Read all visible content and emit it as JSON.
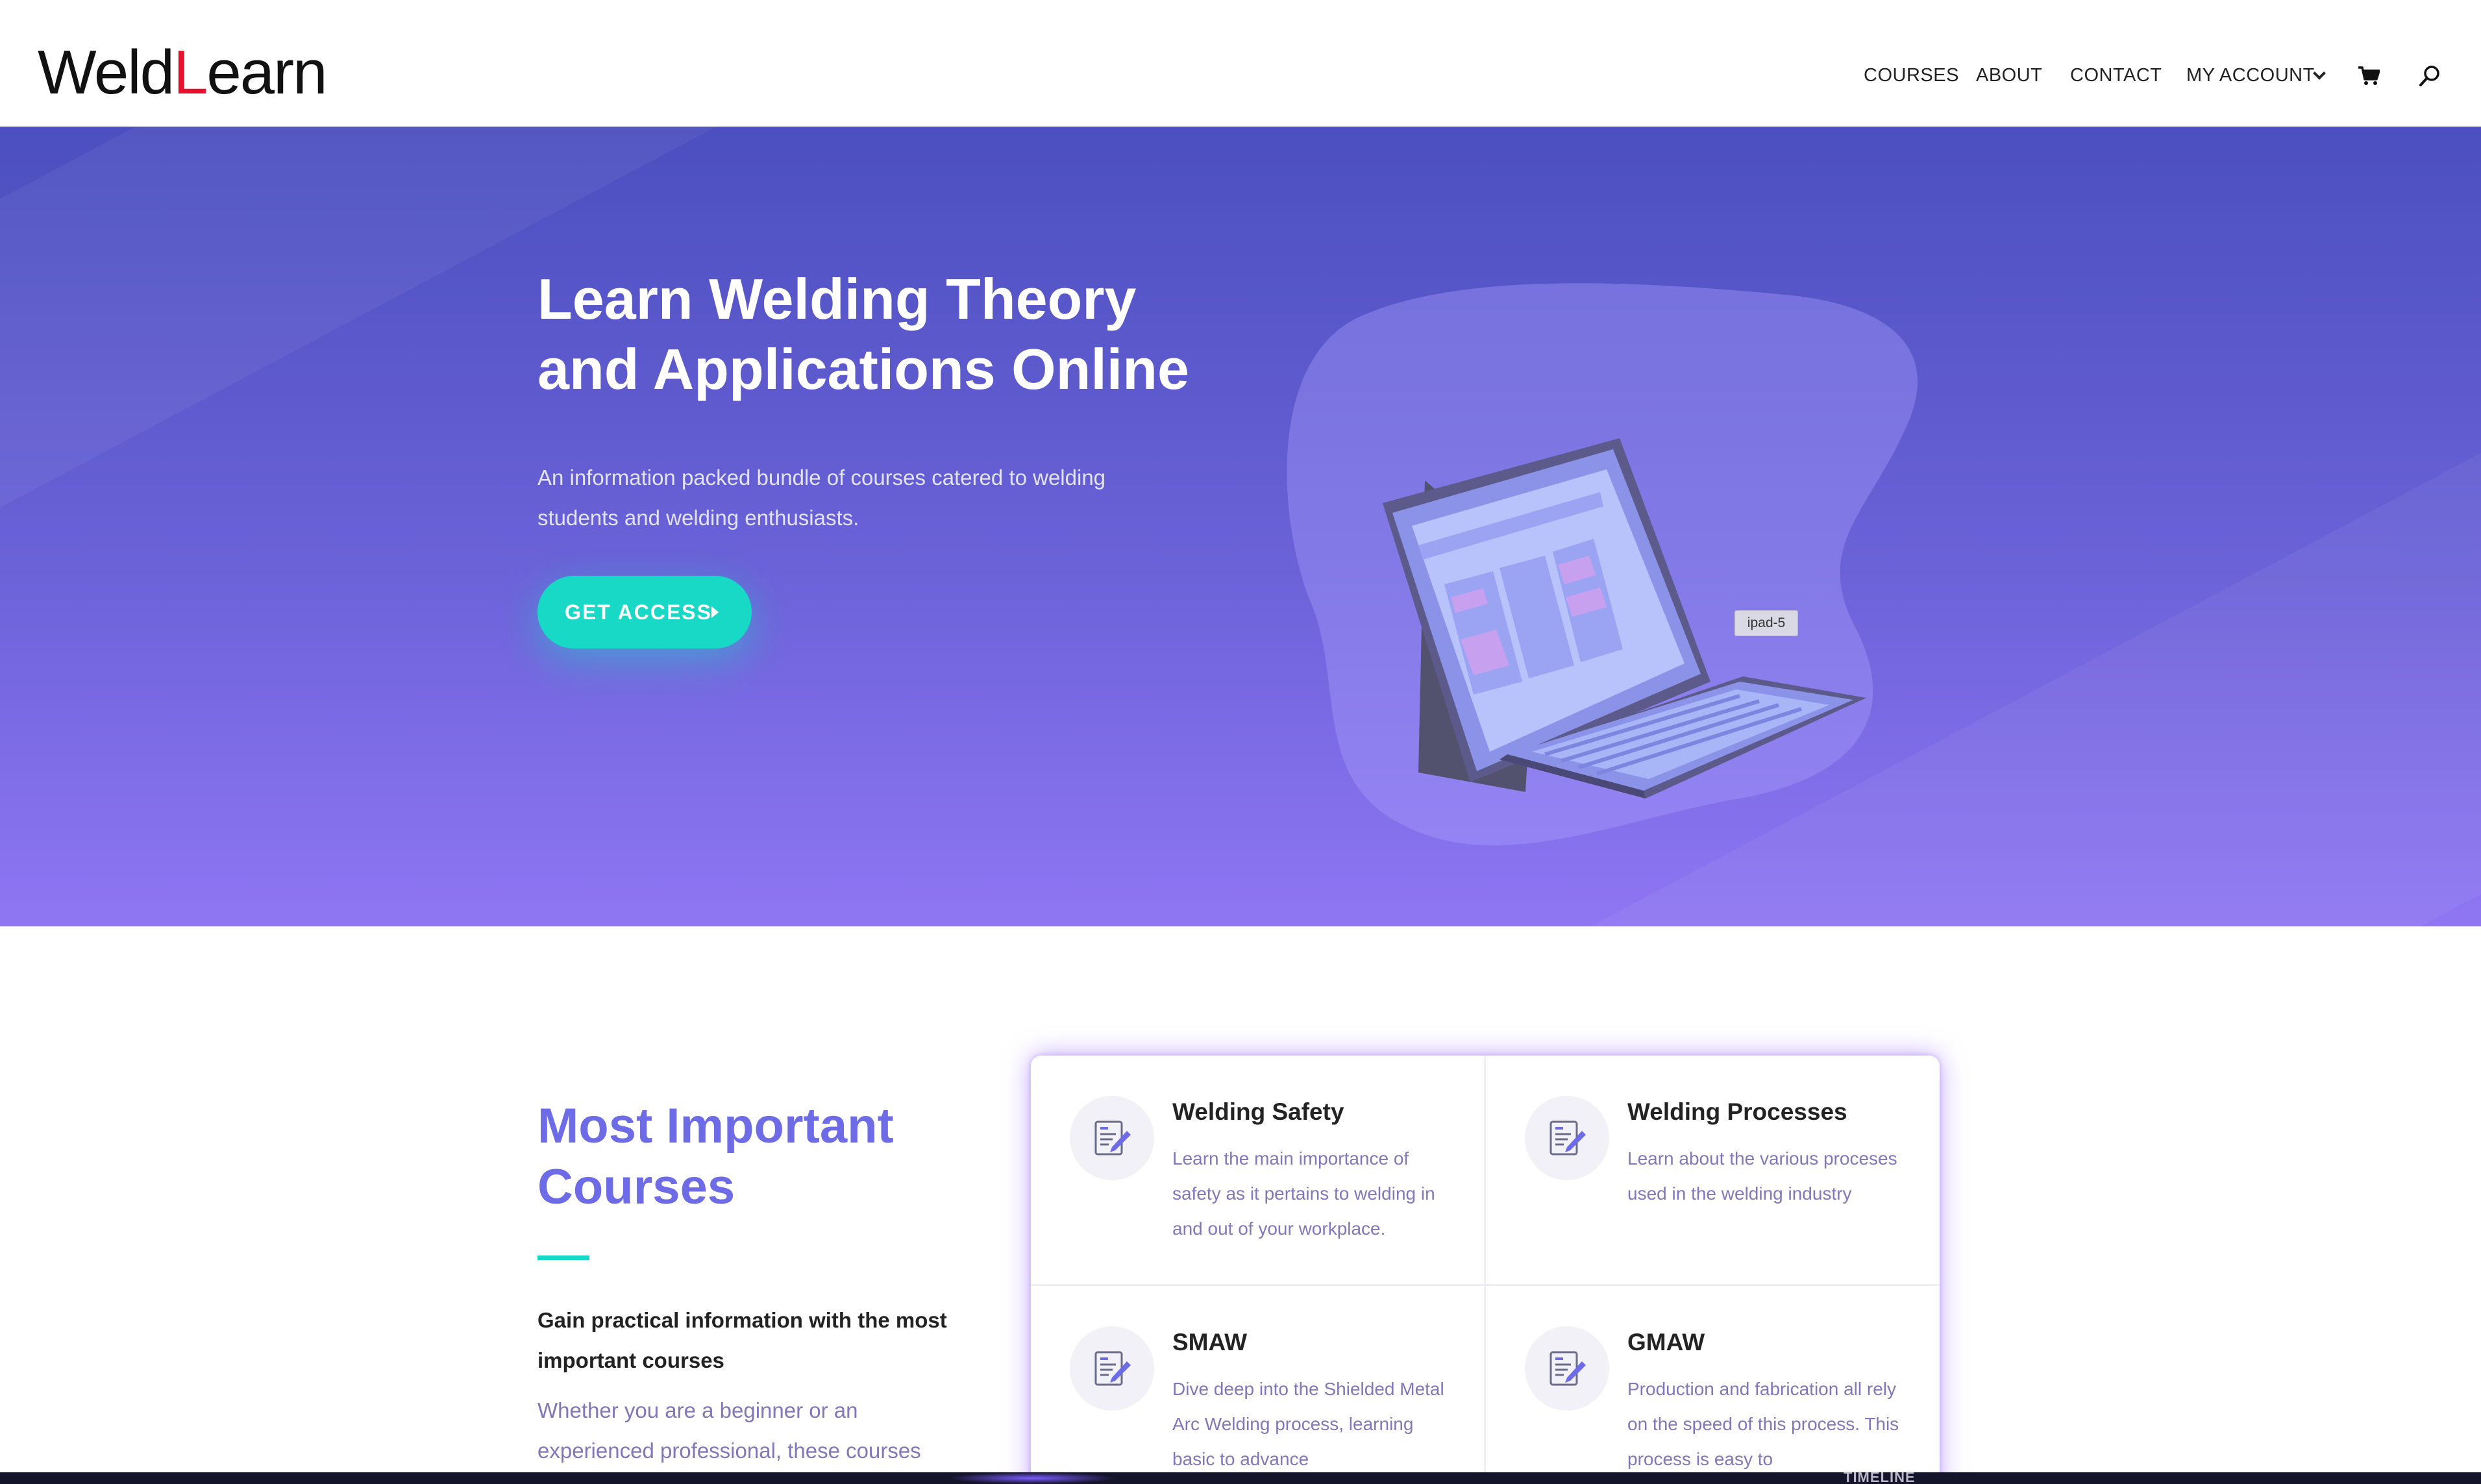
{
  "header": {
    "logo_part1": "Weld",
    "logo_part2": "L",
    "logo_part3": "earn",
    "nav": [
      "COURSES",
      "ABOUT",
      "CONTACT",
      "MY ACCOUNT"
    ],
    "icons": [
      "cart-icon",
      "search-icon",
      "chevron-down-icon"
    ]
  },
  "hero": {
    "title": "Learn Welding Theory and Applications Online",
    "subtitle": "An information packed bundle of courses catered to welding students and welding enthusiasts.",
    "cta_label": "GET ACCESS",
    "image_tag": "ipad-5"
  },
  "courses": {
    "heading": "Most Important Courses",
    "lead": "Gain practical information with the most important courses",
    "body": "Whether you are a beginner or an experienced professional, these courses",
    "cards": [
      {
        "title": "Welding Safety",
        "desc": "Learn the main importance of safety as it pertains to welding in and out of your workplace.",
        "icon": "document-edit-icon"
      },
      {
        "title": "Welding Processes",
        "desc": "Learn about the various proceses used in the welding industry",
        "icon": "document-edit-icon"
      },
      {
        "title": "SMAW",
        "desc": "Dive deep into the Shielded Metal Arc Welding process, learning basic to advance",
        "icon": "document-edit-icon"
      },
      {
        "title": "GMAW",
        "desc": "Production and fabrication all rely on the speed of this process. This process is easy to",
        "icon": "document-edit-icon"
      }
    ]
  },
  "footer_peek": {
    "label": "TIMELINE"
  },
  "colors": {
    "brand_red": "#e8112d",
    "hero_top": "#4b4fbf",
    "hero_bottom": "#8f76f3",
    "cta": "#17d9c6",
    "heading": "#6e6be6",
    "muted_text": "#8277b8"
  }
}
